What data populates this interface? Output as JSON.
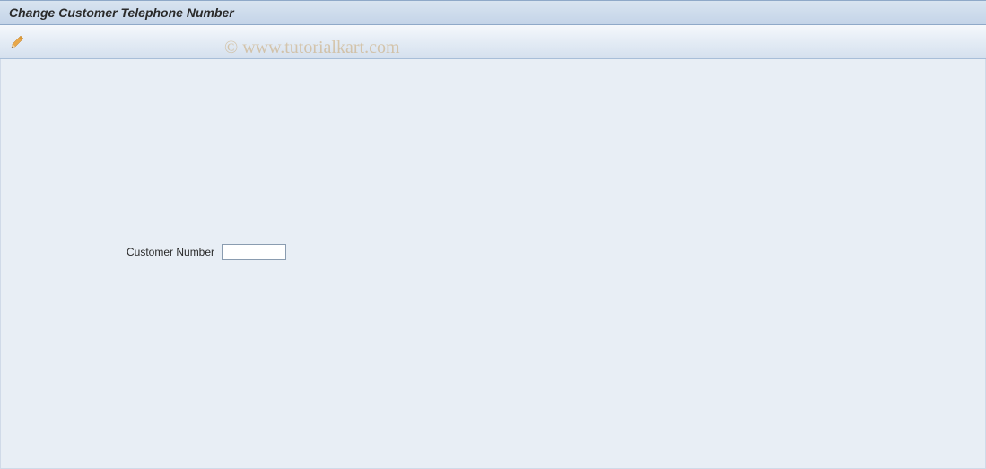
{
  "header": {
    "title": "Change Customer Telephone Number"
  },
  "toolbar": {
    "edit_tooltip": "Change"
  },
  "form": {
    "customer_number_label": "Customer Number",
    "customer_number_value": ""
  },
  "watermark": "© www.tutorialkart.com"
}
